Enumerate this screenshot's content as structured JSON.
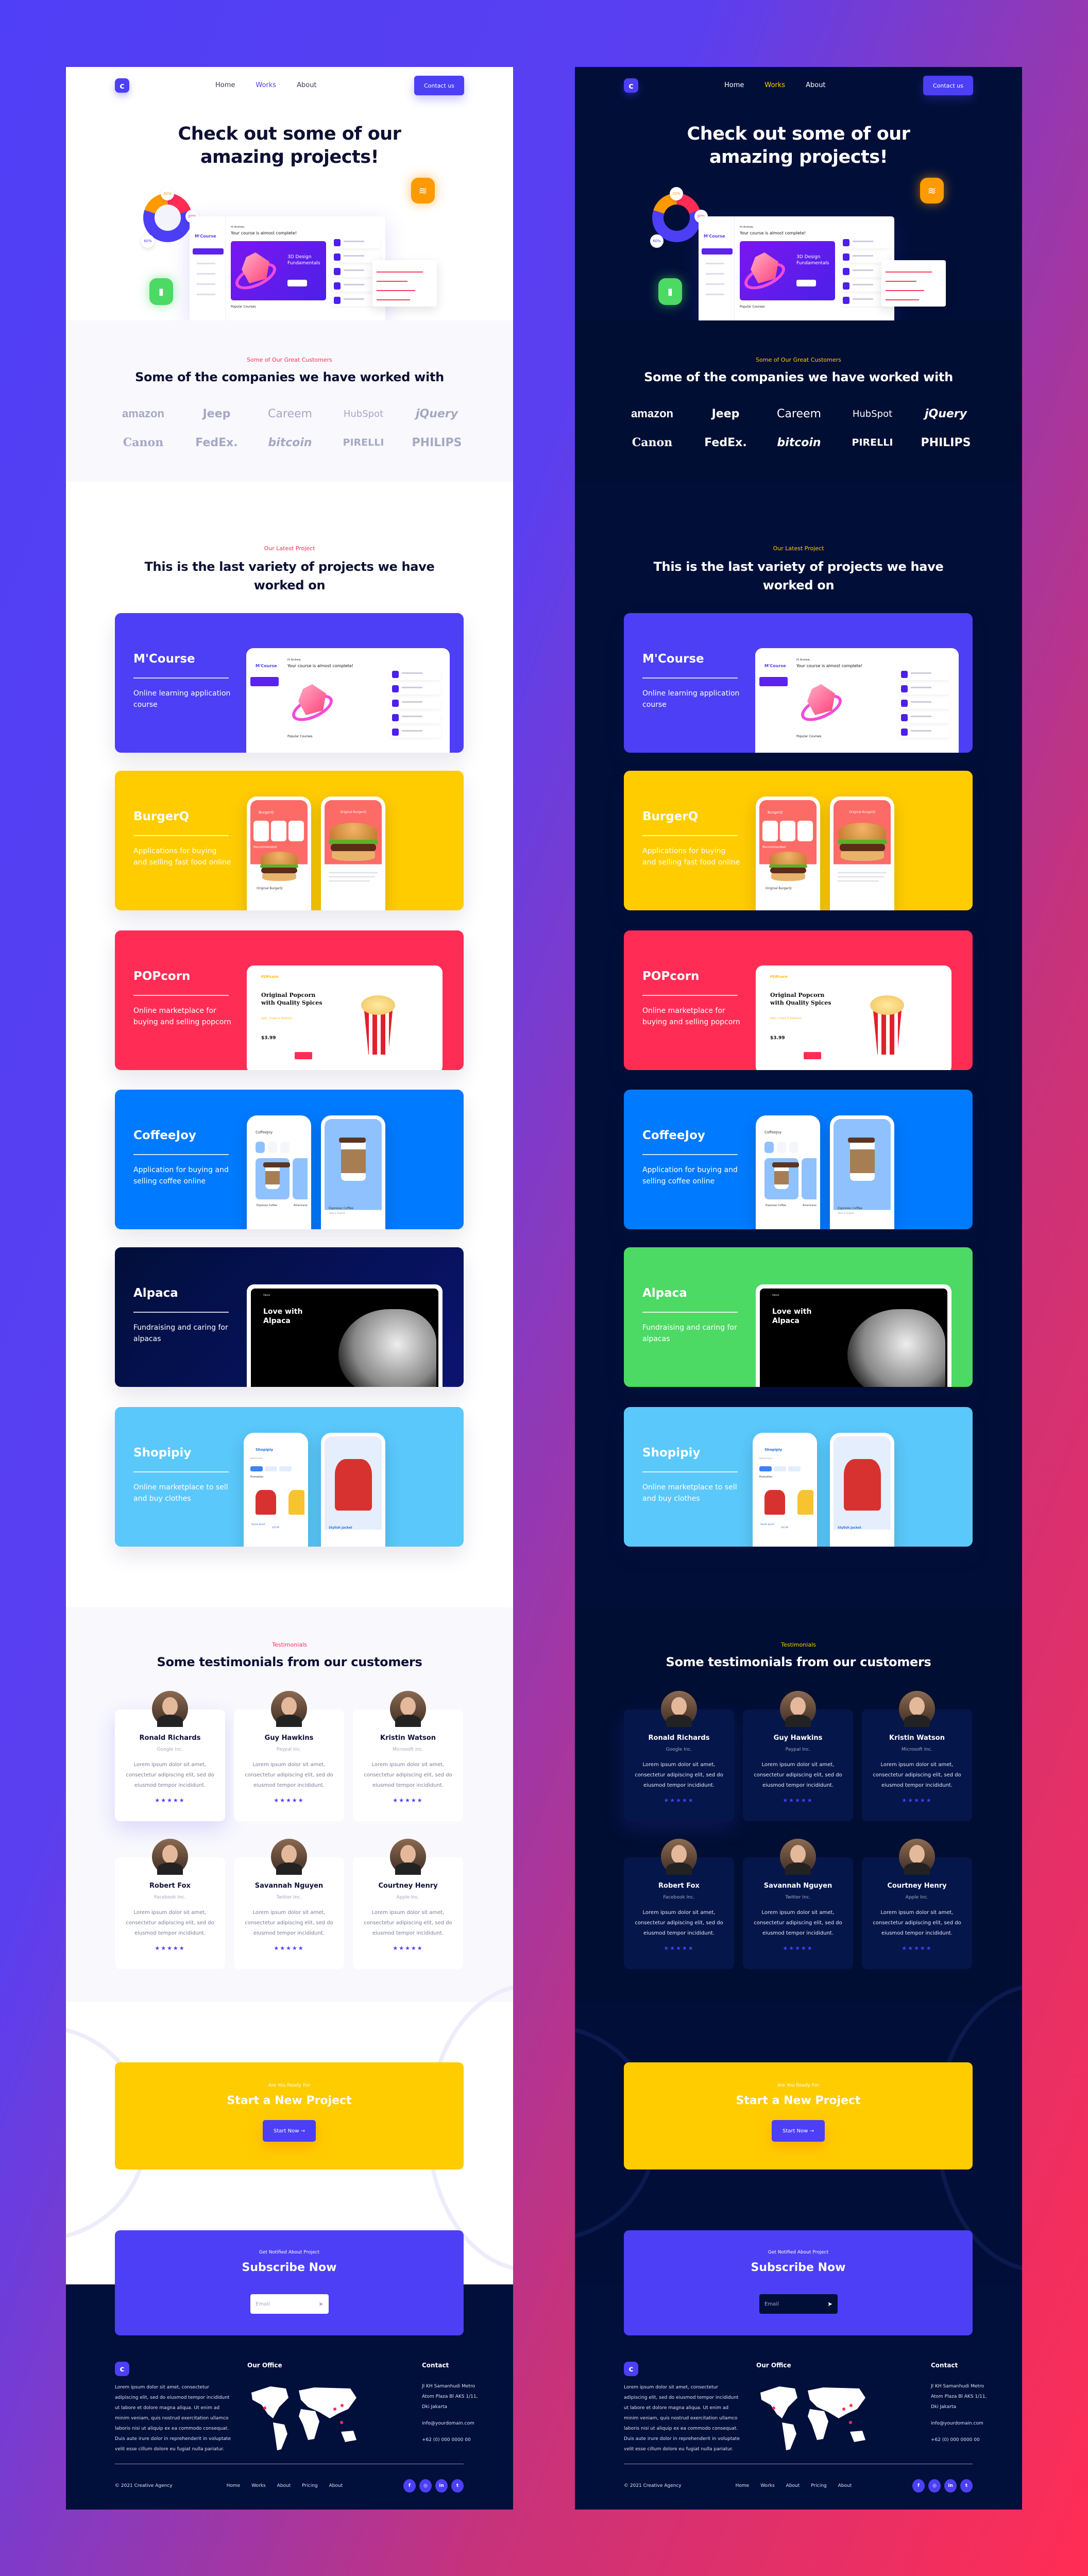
{
  "brand": {
    "logo_letter": "c"
  },
  "colors": {
    "accent": "#4c3ff5",
    "tagline_light": "#ff2d55",
    "tagline_dark": "#ffcc00",
    "dark_bg": "#010f38",
    "cta_yellow": "#ffcc00"
  },
  "header": {
    "nav": [
      {
        "label": "Home"
      },
      {
        "label": "Works",
        "active": true
      },
      {
        "label": "About"
      }
    ],
    "contact_label": "Contact us"
  },
  "hero": {
    "title_line1": "Check out some of our",
    "title_line2": "amazing projects!",
    "illustration": {
      "donut_labels": [
        "20%",
        "20%",
        "60%"
      ],
      "app_name": "M'Course",
      "greeting": "Hi Andrew,",
      "headline": "Your course is almost complete!",
      "banner_title": "3D Design Fundamentals",
      "popular": "Popular Courses",
      "icons": [
        "layers-icon",
        "bar-chart-icon"
      ]
    }
  },
  "customers": {
    "tagline": "Some of Our Great Customers",
    "title": "Some of the companies we have worked with",
    "logos_row1": [
      "amazon",
      "Jeep",
      "Careem",
      "HubSpot",
      "jQuery"
    ],
    "logos_row2": [
      "Canon",
      "FedEx.",
      "bitcoin",
      "PIRELLI",
      "PHILIPS"
    ]
  },
  "projects": {
    "tagline": "Our Latest Project",
    "title_line1": "This is the last variety of projects we have",
    "title_line2": "worked on",
    "items": [
      {
        "name": "M'Course",
        "desc": "Online learning application course",
        "color": "#4c3ff5",
        "color_dark": "#4c3ff5"
      },
      {
        "name": "BurgerQ",
        "desc": "Applications for buying and selling fast food online",
        "color": "#ffcc00",
        "color_dark": "#ffcc00",
        "mock": {
          "screen1": "BurgerQ",
          "screen2": "Original BurgerQ",
          "cats": [
            "Burger",
            "Pizza",
            "Hotdog"
          ],
          "rec": "Recommended"
        }
      },
      {
        "name": "POPcorn",
        "desc": "Online marketplace for buying and selling popcorn",
        "color": "#ff2d55",
        "color_dark": "#ff2d55",
        "mock": {
          "logo": "POPcorn",
          "headline": "Original Popcorn with Quality Spices",
          "sub": "Salty, Crispy & Delicious",
          "price": "$3.99"
        }
      },
      {
        "name": "CoffeeJoy",
        "desc": "Application for buying and selling coffee online",
        "color": "#007aff",
        "color_dark": "#007aff",
        "mock": {
          "screen1": "CoffeeJoy",
          "item1": "Espresso Coffee",
          "item2": "Americano",
          "detail": "Espresso Coffee",
          "detail_sub": "Taste & Original"
        }
      },
      {
        "name": "Alpaca",
        "desc": "Fundraising and caring for alpacas",
        "color": "#010f3b",
        "color_dark": "#4cd964",
        "mock": {
          "logo": "Alpaca",
          "headline": "Love with Alpaca"
        }
      },
      {
        "name": "Shopipiy",
        "desc": "Online marketplace to sell and buy clothes",
        "color": "#5ac8fa",
        "color_dark": "#5ac8fa",
        "mock": {
          "screen1": "Shopipiy",
          "search": "Search here ...",
          "chips": [
            "Clothes",
            "Electronics",
            "Accessories",
            "Others"
          ],
          "promo": "Promotion",
          "item": "Stylish Jacket",
          "price": "$35,99",
          "detail": "Stylish Jacket"
        }
      }
    ]
  },
  "testimonials": {
    "tagline": "Testimonials",
    "title": "Some testimonials from our customers",
    "rating": 5,
    "items": [
      {
        "name": "Ronald Richards",
        "company": "Google Inc.",
        "text": "Lorem ipsum dolor sit amet, consectetur adipiscing elit, sed do eiusmod tempor incididunt.",
        "stars": "★★★★★"
      },
      {
        "name": "Guy Hawkins",
        "company": "Paypal Inc.",
        "text": "Lorem ipsum dolor sit amet, consectetur adipiscing elit, sed do eiusmod tempor incididunt.",
        "stars": "★★★★★"
      },
      {
        "name": "Kristin Watson",
        "company": "Microsoft Inc.",
        "text": "Lorem ipsum dolor sit amet, consectetur adipiscing elit, sed do eiusmod tempor incididunt.",
        "stars": "★★★★★"
      },
      {
        "name": "Robert Fox",
        "company": "Facebook Inc.",
        "text": "Lorem ipsum dolor sit amet, consectetur adipiscing elit, sed do eiusmod tempor incididunt.",
        "stars": "★★★★★"
      },
      {
        "name": "Savannah Nguyen",
        "company": "Twitter Inc.",
        "text": "Lorem ipsum dolor sit amet, consectetur adipiscing elit, sed do eiusmod tempor incididunt.",
        "stars": "★★★★★"
      },
      {
        "name": "Courtney Henry",
        "company": "Apple Inc.",
        "text": "Lorem ipsum dolor sit amet, consectetur adipiscing elit, sed do eiusmod tempor incididunt.",
        "stars": "★★★★★"
      }
    ]
  },
  "cta": {
    "eyebrow": "Are You Ready For",
    "title": "Start a New Project",
    "button": "Start Now",
    "button_icon": "→"
  },
  "subscribe": {
    "eyebrow": "Get Notified About Project",
    "title": "Subscribe Now",
    "placeholder": "Email",
    "send_icon": "➤"
  },
  "footer": {
    "about": "Lorem ipsum dolor sit amet, consectetur adipiscing elit, sed do eiusmod tempor incididunt ut labore et dolore magna aliqua. Ut enim ad minim veniam, quis nostrud exercitation ullamco laboris nisi ut aliquip ex ea commodo consequat. Duis aute irure dolor in reprehenderit in voluptate velit esse cillum dolore eu fugiat nulla pariatur.",
    "office_title": "Our Office",
    "contact_title": "Contact",
    "address": "Jl KH Samanhudi Metro Atom Plaza Bl AKS 1/11, Dki Jakarta",
    "email": "info@yourdomain.com",
    "phone": "+62 (0) 000 0000 00",
    "copyright": "© 2021 Creative Agency",
    "links": [
      "Home",
      "Works",
      "About",
      "Pricing",
      "About"
    ],
    "social": [
      {
        "icon": "facebook-icon",
        "glyph": "f"
      },
      {
        "icon": "instagram-icon",
        "glyph": "◎"
      },
      {
        "icon": "linkedin-icon",
        "glyph": "in"
      },
      {
        "icon": "twitter-icon",
        "glyph": "t"
      }
    ]
  }
}
